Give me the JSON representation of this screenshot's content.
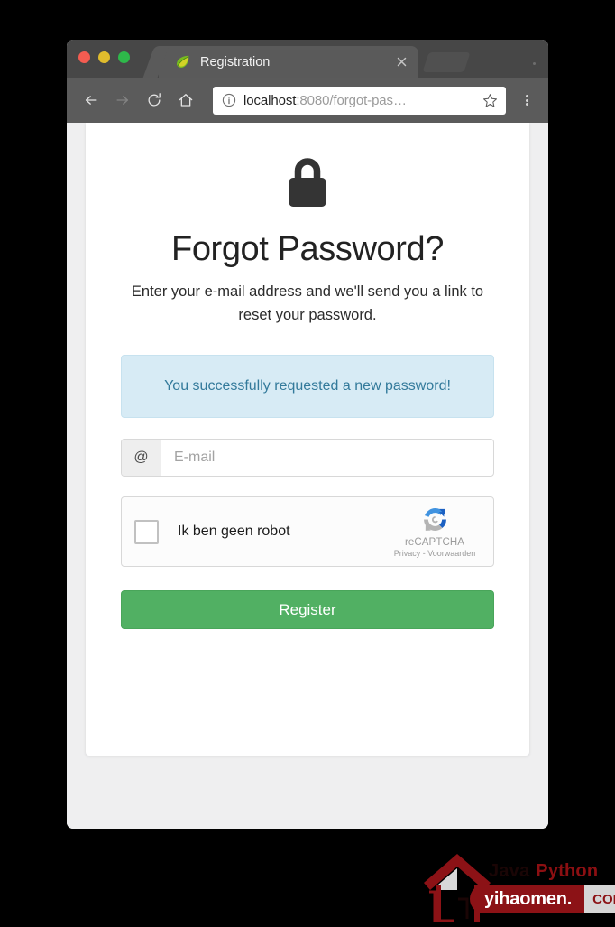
{
  "browser": {
    "traffic_lights": [
      {
        "name": "close",
        "color": "#f45c51"
      },
      {
        "name": "minimize",
        "color": "#e0bc2d"
      },
      {
        "name": "zoom",
        "color": "#2eb84a"
      }
    ],
    "tab": {
      "title": "Registration",
      "favicon": "spring-leaf-icon",
      "close_label": "×"
    },
    "toolbar": {
      "back_icon": "arrow-left-icon",
      "forward_icon": "arrow-right-icon",
      "reload_icon": "reload-icon",
      "home_icon": "home-icon",
      "menu_icon": "three-dot-menu-icon"
    },
    "omnibox": {
      "info_icon": "info-circle-icon",
      "url_host": "localhost",
      "url_rest": ":8080/forgot-pas…",
      "star_icon": "bookmark-star-icon"
    }
  },
  "page": {
    "lock_icon": "padlock-icon",
    "title": "Forgot Password?",
    "subtitle": "Enter your e-mail address and we'll send you a link to reset your password.",
    "alert": {
      "message": "You successfully requested a new password!",
      "bg_color": "#d7ebf5",
      "border_color": "#c7e2ef",
      "text_color": "#337a9b"
    },
    "email_field": {
      "addon_symbol": "@",
      "placeholder": "E-mail",
      "value": ""
    },
    "recaptcha": {
      "checkbox_checked": false,
      "label": "Ik ben geen robot",
      "brand": "reCAPTCHA",
      "privacy_label": "Privacy",
      "separator": " - ",
      "terms_label": "Voorwaarden",
      "logo_icon": "recaptcha-logo-icon"
    },
    "submit": {
      "label": "Register",
      "color": "#51b063"
    }
  },
  "watermark": {
    "word_java": "Java",
    "word_python": "Python",
    "site": "yihaomen.",
    "tld": "COM",
    "logo_icon": "house-logo-icon",
    "brand_color": "#8c1216"
  }
}
